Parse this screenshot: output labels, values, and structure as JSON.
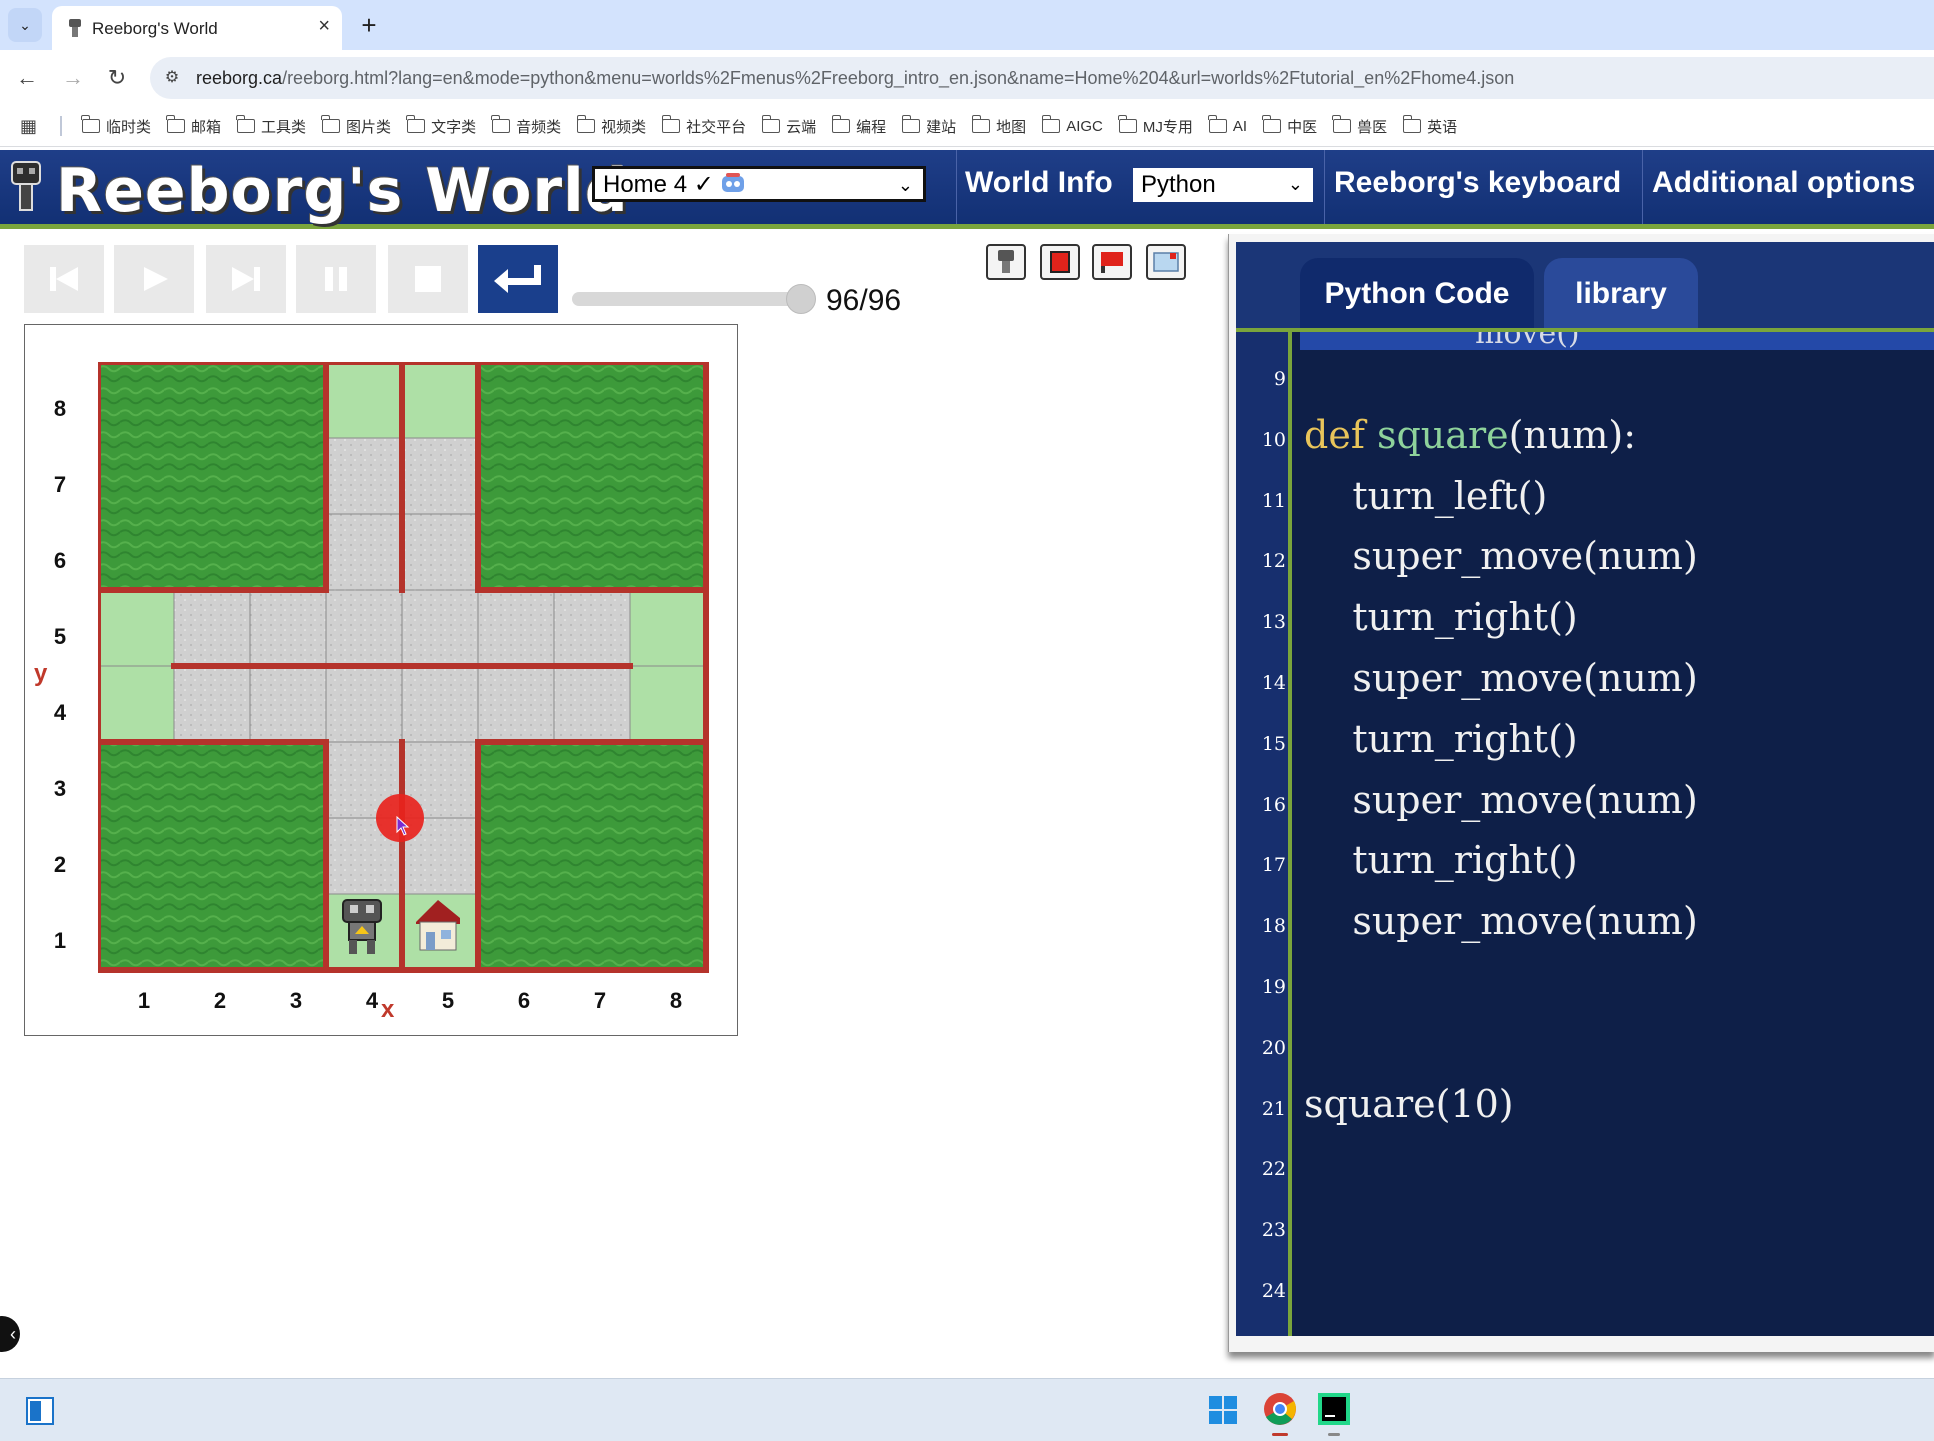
{
  "browser": {
    "tab_title": "Reeborg's World",
    "url_domain": "reeborg.ca",
    "url_path": "/reeborg.html?lang=en&mode=python&menu=worlds%2Fmenus%2Freeborg_intro_en.json&name=Home%204&url=worlds%2Ftutorial_en%2Fhome4.json",
    "bookmarks": [
      "临时类",
      "邮箱",
      "工具类",
      "图片类",
      "文字类",
      "音频类",
      "视频类",
      "社交平台",
      "云端",
      "编程",
      "建站",
      "地图",
      "AIGC",
      "MJ专用",
      "AI",
      "中医",
      "兽医",
      "英语"
    ]
  },
  "header": {
    "title": "Reeborg's World",
    "world_selected": "Home 4 ✓",
    "world_info": "World Info",
    "language_selected": "Python",
    "keyboard": "Reeborg's keyboard",
    "additional_options": "Additional options"
  },
  "controls": {
    "step_counter": "96/96",
    "speed_level": 1.0
  },
  "world": {
    "y_axis_label": "y",
    "x_axis_label": "x",
    "y_ticks": [
      "8",
      "7",
      "6",
      "5",
      "4",
      "3",
      "2",
      "1"
    ],
    "x_ticks": [
      "1",
      "2",
      "3",
      "4",
      "5",
      "6",
      "7",
      "8"
    ],
    "robot_position": [
      4,
      1
    ],
    "home_position": [
      5,
      1
    ],
    "colors": {
      "grass": "#3f9a3c",
      "tile": "#cfcfcf",
      "light_green": "#aee0a6",
      "wall": "#b5332b"
    }
  },
  "editor": {
    "tabs": [
      "Python Code",
      "library"
    ],
    "partial_line": "move()",
    "lines": [
      {
        "n": "9",
        "parts": []
      },
      {
        "n": "10",
        "parts": [
          {
            "t": "def",
            "c": "kw"
          },
          {
            "t": " ",
            "c": ""
          },
          {
            "t": "square",
            "c": "fn"
          },
          {
            "t": "(num):",
            "c": ""
          }
        ]
      },
      {
        "n": "11",
        "parts": [
          {
            "t": "    turn_left()",
            "c": ""
          }
        ]
      },
      {
        "n": "12",
        "parts": [
          {
            "t": "    super_move(num)",
            "c": ""
          }
        ]
      },
      {
        "n": "13",
        "parts": [
          {
            "t": "    turn_right()",
            "c": ""
          }
        ]
      },
      {
        "n": "14",
        "parts": [
          {
            "t": "    super_move(num)",
            "c": ""
          }
        ]
      },
      {
        "n": "15",
        "parts": [
          {
            "t": "    turn_right()",
            "c": ""
          }
        ]
      },
      {
        "n": "16",
        "parts": [
          {
            "t": "    super_move(num)",
            "c": ""
          }
        ]
      },
      {
        "n": "17",
        "parts": [
          {
            "t": "    turn_right()",
            "c": ""
          }
        ]
      },
      {
        "n": "18",
        "parts": [
          {
            "t": "    super_move(num)",
            "c": ""
          }
        ]
      },
      {
        "n": "19",
        "parts": []
      },
      {
        "n": "20",
        "parts": []
      },
      {
        "n": "21",
        "parts": [
          {
            "t": "square(10)",
            "c": ""
          }
        ]
      },
      {
        "n": "22",
        "parts": []
      },
      {
        "n": "23",
        "parts": []
      },
      {
        "n": "24",
        "parts": []
      }
    ]
  }
}
